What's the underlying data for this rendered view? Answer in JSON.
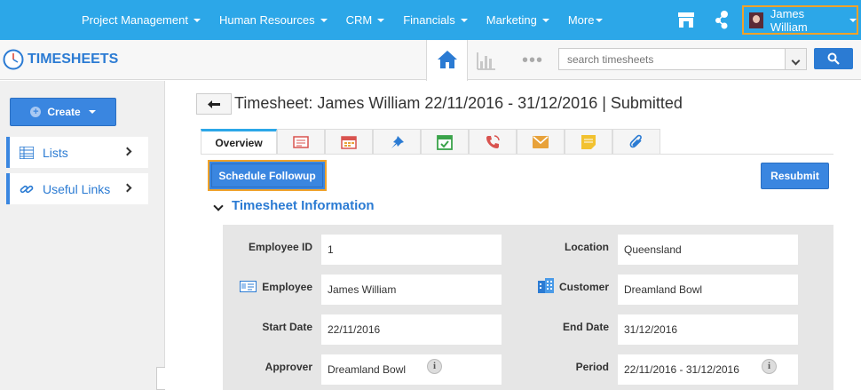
{
  "topnav": {
    "items": [
      {
        "label": "Project Management"
      },
      {
        "label": "Human Resources"
      },
      {
        "label": "CRM"
      },
      {
        "label": "Financials"
      },
      {
        "label": "Marketing"
      },
      {
        "label": "More"
      }
    ],
    "user_name": "James William",
    "icons": [
      "store-icon",
      "connect-icon",
      "avatar"
    ]
  },
  "appbar": {
    "title": "TIMESHEETS",
    "search_placeholder": "search timesheets",
    "icons": [
      "clock-icon",
      "home-icon",
      "chart-icon",
      "more-icon",
      "search-icon"
    ]
  },
  "sidebar": {
    "create_label": "Create",
    "items": [
      {
        "label": "Lists",
        "icon": "list-icon"
      },
      {
        "label": "Useful Links",
        "icon": "link-icon"
      }
    ]
  },
  "main": {
    "title": "Timesheet: James William 22/11/2016 - 31/12/2016 | Submitted",
    "tabs": [
      {
        "label": "Overview"
      },
      {
        "icon": "notes-icon"
      },
      {
        "icon": "calendar-icon"
      },
      {
        "icon": "pin-icon"
      },
      {
        "icon": "task-icon"
      },
      {
        "icon": "phone-icon"
      },
      {
        "icon": "email-icon"
      },
      {
        "icon": "sticky-note-icon"
      },
      {
        "icon": "attachment-icon"
      }
    ],
    "schedule_label": "Schedule Followup",
    "resubmit_label": "Resubmit",
    "section_title": "Timesheet Information",
    "fields": {
      "employee_id": {
        "label": "Employee ID",
        "value": "1"
      },
      "location": {
        "label": "Location",
        "value": "Queensland"
      },
      "employee": {
        "label": "Employee",
        "value": "James William"
      },
      "customer": {
        "label": "Customer",
        "value": "Dreamland Bowl"
      },
      "start_date": {
        "label": "Start Date",
        "value": "22/11/2016"
      },
      "end_date": {
        "label": "End Date",
        "value": "31/12/2016"
      },
      "approver": {
        "label": "Approver",
        "value": "Dreamland Bowl"
      },
      "period": {
        "label": "Period",
        "value": "22/11/2016 - 31/12/2016"
      }
    }
  },
  "colors": {
    "topbar": "#2ca7e8",
    "accent": "#2b7bd3",
    "button": "#3a86e0",
    "highlight": "#f0a229"
  }
}
